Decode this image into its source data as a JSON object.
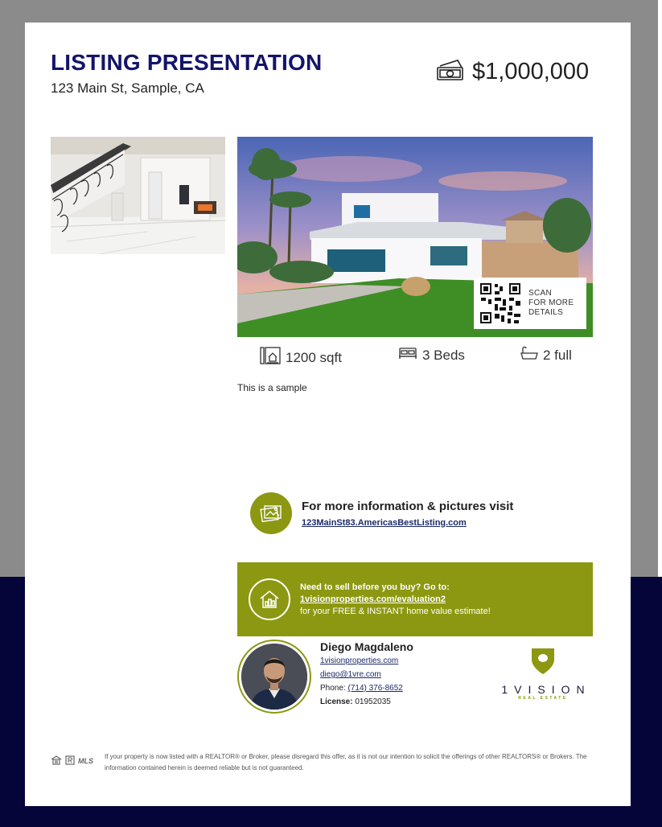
{
  "header": {
    "title": "LISTING PRESENTATION",
    "address": "123 Main St, Sample, CA",
    "price": "$1,000,000",
    "price_icon": "money-icon"
  },
  "qr": {
    "line1": "SCAN",
    "line2": "FOR MORE",
    "line3": "DETAILS"
  },
  "stats": {
    "sqft": "1200 sqft",
    "beds": "3 Beds",
    "baths": "2 full"
  },
  "description": "This is a sample",
  "info": {
    "title": "For more information & pictures visit",
    "link": "123MainSt83.AmericasBestListing.com"
  },
  "banner": {
    "line1": "Need to sell before you buy? Go to:",
    "link": "1visionproperties.com/evaluation2",
    "line3": "for your FREE & INSTANT home value estimate!"
  },
  "agent": {
    "name": "Diego Magdaleno",
    "website": "1visionproperties.com",
    "email": "diego@1vre.com",
    "phone_label": "Phone:",
    "phone": "(714) 376-8652",
    "license_label": "License:",
    "license": "01952035"
  },
  "logo": {
    "word": "1VISION",
    "sub": "REAL ESTATE"
  },
  "footer": {
    "mls": "MLS",
    "disclaimer": "If your property is now listed with a REALTOR® or Broker, please disregard this offer, as it is not our intention to solicit the offerings of other REALTORS® or Brokers. The information contained herein is deemed reliable but is not guaranteed."
  },
  "colors": {
    "navy": "#14146b",
    "olive": "#8c9811",
    "dark_bg": "#06053a"
  }
}
